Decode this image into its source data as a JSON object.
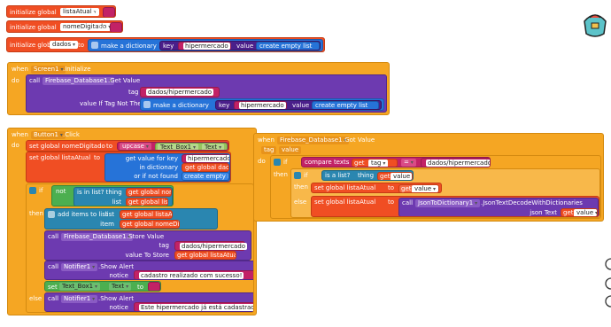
{
  "globals": [
    {
      "prefix": "initialize global",
      "name": "listaAtual",
      "to": "to"
    },
    {
      "prefix": "initialize global",
      "name": "nomeDigitado",
      "to": "to"
    },
    {
      "prefix": "initialize global",
      "name": "dados",
      "to": "to",
      "dict": "make a dictionary",
      "key": "key",
      "key_value": "hipermercado",
      "value": "value",
      "value_block": "create empty list"
    }
  ],
  "screen_init": {
    "when": "when",
    "component": "Screen1",
    "event": ".Initialize",
    "do": "do",
    "call": "call",
    "db": "Firebase_Database1",
    "method": ".Get Value",
    "tag_label": "tag",
    "tag_value": "dados/hipermercado",
    "if_not_there": "value If Tag Not There",
    "dict": "make a dictionary",
    "key": "key",
    "key_value": "hipermercado",
    "value": "value",
    "value_block": "create empty list"
  },
  "button_click": {
    "when": "when",
    "component": "Button1",
    "event": ".Click",
    "do": "do",
    "set1": "set global nomeDigitado",
    "to": "to",
    "upcase": "upcase",
    "textbox": "Text_Box1",
    "text": "Text",
    "set2": "set global listaAtual",
    "get_value_key": "get value for key",
    "key_value": "hipermercado",
    "in_dict": "in dictionary",
    "get_dados": "get global dados",
    "or_not_found": "or if not found",
    "create_empty": "create empty list",
    "if": "if",
    "not": "not",
    "is_in_list": "is in list? thing",
    "get_nome": "get global nomeDigitado",
    "list": "list",
    "get_lista": "get global listaAtual",
    "then": "then",
    "add_items": "add items to list",
    "list_label": "list",
    "item_label": "item",
    "get_lista2": "get global listaAtual",
    "get_nome2": "get global nomeDigitado",
    "call": "call",
    "db": "Firebase_Database1",
    "store": ".Store Value",
    "tag_label": "tag",
    "tag_value": "dados/hipermercado",
    "value_to_store": "value To Store",
    "get_lista3": "get global listaAtual",
    "notifier": "Notifier1",
    "show_alert": ".Show Alert",
    "notice": "notice",
    "notice1": "cadastro realizado com sucesso!",
    "set_label": "set",
    "text_box": "Text_Box1",
    "text_prop": "Text",
    "else": "else",
    "notice2": "Este hipermercado já está cadastrado"
  },
  "got_value": {
    "when": "when",
    "db": "Firebase_Database1",
    "event": ".Got Value",
    "params": [
      "tag",
      "value"
    ],
    "do": "do",
    "if": "if",
    "compare": "compare texts",
    "get_tag": "get",
    "tag_param": "tag",
    "eq": "=",
    "tag_value": "dados/hipermercado",
    "then": "then",
    "is_list": "is a list?",
    "thing": "thing",
    "get_value": "get",
    "value_param": "value",
    "set_lista": "set global listaAtual",
    "to": "to",
    "else": "else",
    "call": "call",
    "json": "JsonToDictionary1",
    "method": ".JsonTextDecodeWithDictionaries",
    "json_text": "json Text"
  },
  "colors": {
    "variables": "#f04e23",
    "event": "#f5a623",
    "procedure": "#6d3ab0",
    "text": "#c22266",
    "dictionary": "#2673d8",
    "logic": "#4caf50"
  }
}
